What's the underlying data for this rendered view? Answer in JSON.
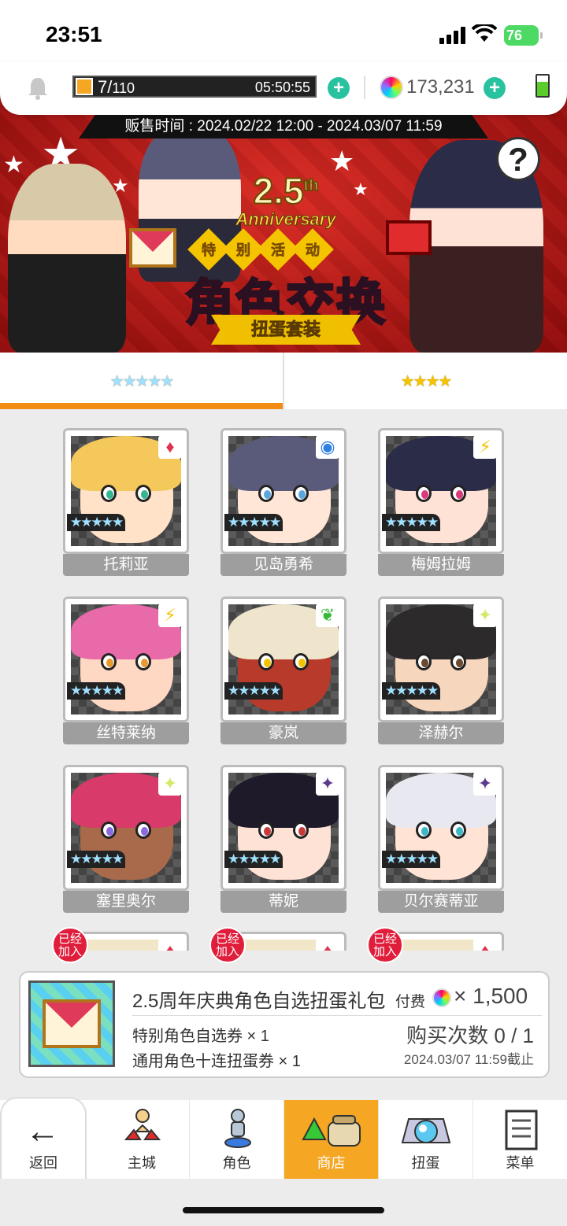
{
  "status_bar": {
    "time": "23:51",
    "battery": "76"
  },
  "resources": {
    "stamina_current": "7/",
    "stamina_max": "110",
    "stamina_fraction": 0.064,
    "stamina_timer": "05:50:55",
    "gems": "173,231"
  },
  "banner": {
    "sale_time": "贩售时间 : 2024.02/22 12:00 - 2024.03/07 11:59",
    "anniv_num": "2.5",
    "anniv_sup": "th",
    "anniv_word": "Anniversary",
    "tag_chars": [
      "特",
      "别",
      "活",
      "动"
    ],
    "headline": "角色交换",
    "ribbon": "扭蛋套装",
    "help": "?"
  },
  "tabs": [
    {
      "stars": "★★★★★",
      "active": true
    },
    {
      "stars": "★★★★",
      "active": false
    }
  ],
  "characters": [
    {
      "name": "托莉亚",
      "stars": "★★★★★",
      "element": "♦",
      "element_color": "#e0314f",
      "hair": "#f4c85a",
      "skin": "#ffe2c8",
      "iris": "#36b68e"
    },
    {
      "name": "见岛勇希",
      "stars": "★★★★★",
      "element": "◉",
      "element_color": "#2f7fe0",
      "hair": "#5a5a7a",
      "skin": "#ffe6d6",
      "iris": "#5aa6e0"
    },
    {
      "name": "梅姆拉姆",
      "stars": "★★★★★",
      "element": "⚡",
      "element_color": "#f5c400",
      "hair": "#2a2c48",
      "skin": "#ffe2d6",
      "iris": "#d83a7a"
    },
    {
      "name": "丝特莱纳",
      "stars": "★★★★★",
      "element": "⚡",
      "element_color": "#f5c400",
      "hair": "#e86aa8",
      "skin": "#ffd8c4",
      "iris": "#e89a30"
    },
    {
      "name": "豪岚",
      "stars": "★★★★★",
      "element": "❦",
      "element_color": "#36b836",
      "hair": "#efe4cc",
      "skin": "#b83a2a",
      "iris": "#f2c400"
    },
    {
      "name": "泽赫尔",
      "stars": "★★★★★",
      "element": "✦",
      "element_color": "#d6e86a",
      "hair": "#2c2a2a",
      "skin": "#f6d6bc",
      "iris": "#6a4a30"
    },
    {
      "name": "塞里奥尔",
      "stars": "★★★★★",
      "element": "✦",
      "element_color": "#d6e86a",
      "hair": "#d83a6a",
      "skin": "#a86a4a",
      "iris": "#8a6ae0"
    },
    {
      "name": "蒂妮",
      "stars": "★★★★★",
      "element": "✦",
      "element_color": "#5a3a8a",
      "hair": "#1e1a2a",
      "skin": "#ffe2d6",
      "iris": "#c83a3a"
    },
    {
      "name": "贝尔赛蒂亚",
      "stars": "★★★★★",
      "element": "✦",
      "element_color": "#5a3a8a",
      "hair": "#e8e8f0",
      "skin": "#ffe4d6",
      "iris": "#3ab8c8"
    }
  ],
  "partial_cards": [
    {
      "badge": "已经\n加入",
      "element": "♦"
    },
    {
      "badge": "已经\n加入",
      "element": "♦"
    },
    {
      "badge": "已经\n加入",
      "element": "♦"
    }
  ],
  "pack": {
    "title": "2.5周年庆典角色自选扭蛋礼包",
    "pay_label": "付费",
    "price": "× 1,500",
    "item1": "特别角色自选券 × 1",
    "item2": "通用角色十连扭蛋券 × 1",
    "count": "购买次数 0 / 1",
    "deadline": "2024.03/07 11:59截止"
  },
  "nav": {
    "back": "返回",
    "items": [
      "主城",
      "角色",
      "商店",
      "扭蛋",
      "菜单"
    ],
    "active_index": 2
  }
}
